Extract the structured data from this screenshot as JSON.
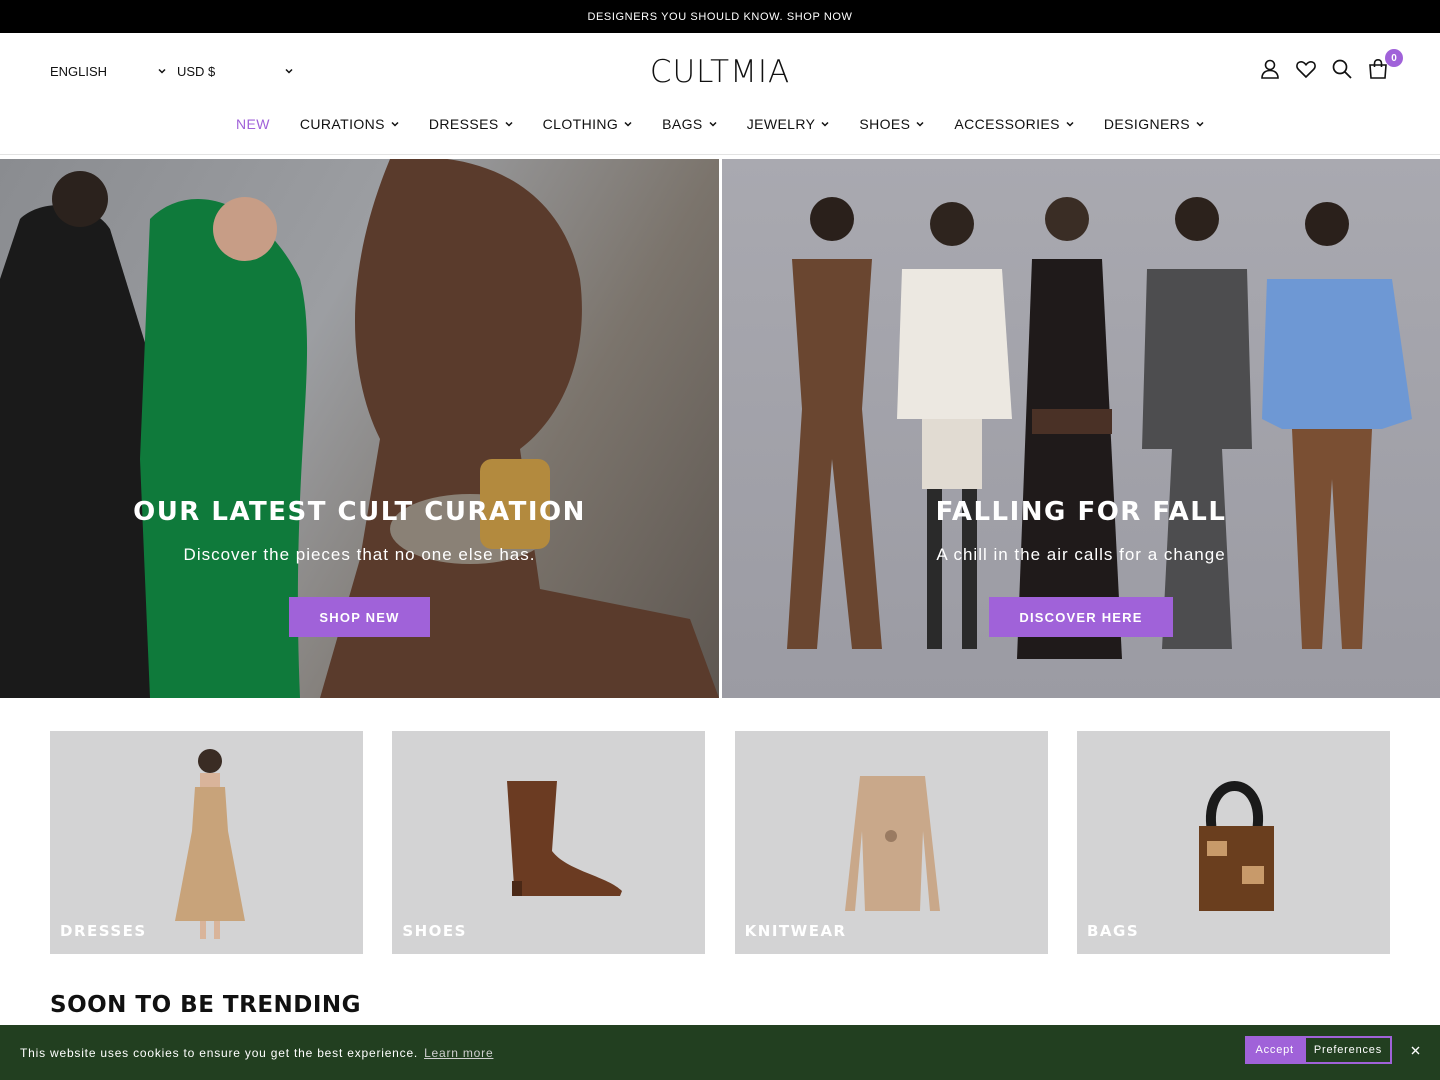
{
  "announcement": "DESIGNERS YOU SHOULD KNOW. SHOP NOW",
  "header": {
    "language": "ENGLISH",
    "currency": "USD $",
    "logo": "CULTMIA",
    "cart_count": "0"
  },
  "nav": {
    "items": [
      {
        "label": "NEW"
      },
      {
        "label": "CURATIONS"
      },
      {
        "label": "DRESSES"
      },
      {
        "label": "CLOTHING"
      },
      {
        "label": "BAGS"
      },
      {
        "label": "JEWELRY"
      },
      {
        "label": "SHOES"
      },
      {
        "label": "ACCESSORIES"
      },
      {
        "label": "DESIGNERS"
      }
    ]
  },
  "heroes": [
    {
      "title": "OUR LATEST CULT CURATION",
      "subtitle": "Discover the pieces that no one else has.",
      "button": "SHOP NEW"
    },
    {
      "title": "FALLING FOR FALL",
      "subtitle": "A chill in the air calls for a change",
      "button": "DISCOVER HERE"
    }
  ],
  "categories": [
    {
      "label": "DRESSES"
    },
    {
      "label": "SHOES"
    },
    {
      "label": "KNITWEAR"
    },
    {
      "label": "BAGS"
    }
  ],
  "section_title": "SOON TO BE TRENDING",
  "cookie": {
    "message": "This website uses cookies to ensure you get the best experience.",
    "link": "Learn more",
    "accept": "Accept",
    "preferences": "Preferences"
  },
  "colors": {
    "accent": "#a062d9",
    "cookie_bg": "#223f20",
    "announcement_bg": "#000000"
  }
}
